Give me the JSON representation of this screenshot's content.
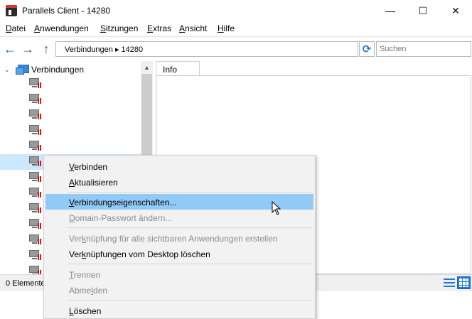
{
  "window": {
    "title": "Parallels Client - 14280",
    "minimize_glyph": "—",
    "maximize_glyph": "☐",
    "close_glyph": "✕"
  },
  "menu": {
    "items": [
      {
        "u": "D",
        "rest": "atei"
      },
      {
        "u": "A",
        "rest": "nwendungen"
      },
      {
        "u": "S",
        "rest": "itzungen"
      },
      {
        "u": "E",
        "rest": "xtras"
      },
      {
        "u": "A",
        "rest": "nsicht"
      },
      {
        "u": "H",
        "rest": "ilfe"
      }
    ]
  },
  "nav": {
    "back_glyph": "←",
    "forward_glyph": "→",
    "up_glyph": "↑",
    "breadcrumb": "Verbindungen ▸ 14280",
    "refresh_glyph": "⟳",
    "search_placeholder": "Suchen"
  },
  "tree": {
    "expander_glyph": "⌄",
    "root_label": "Verbindungen",
    "scroll_up_glyph": "▲"
  },
  "tabs": {
    "info": "Info"
  },
  "status": {
    "text": "0 Elemente"
  },
  "context_menu": {
    "items": [
      {
        "pre": "",
        "u": "V",
        "post": "erbinden"
      },
      {
        "pre": "",
        "u": "A",
        "post": "ktualisieren"
      },
      {
        "pre": "",
        "u": "V",
        "post": "erbindungseigenschaften..."
      },
      {
        "pre": "",
        "u": "D",
        "post": "omain-Passwort ändern..."
      },
      {
        "pre": "Ver",
        "u": "k",
        "post": "nüpfung für alle sichtbaren Anwendungen erstellen"
      },
      {
        "pre": "Ver",
        "u": "k",
        "post": "nüpfungen vom Desktop löschen"
      },
      {
        "pre": "",
        "u": "T",
        "post": "rennen"
      },
      {
        "pre": "Abme",
        "u": "l",
        "post": "den"
      },
      {
        "pre": "",
        "u": "L",
        "post": "öschen"
      }
    ]
  }
}
